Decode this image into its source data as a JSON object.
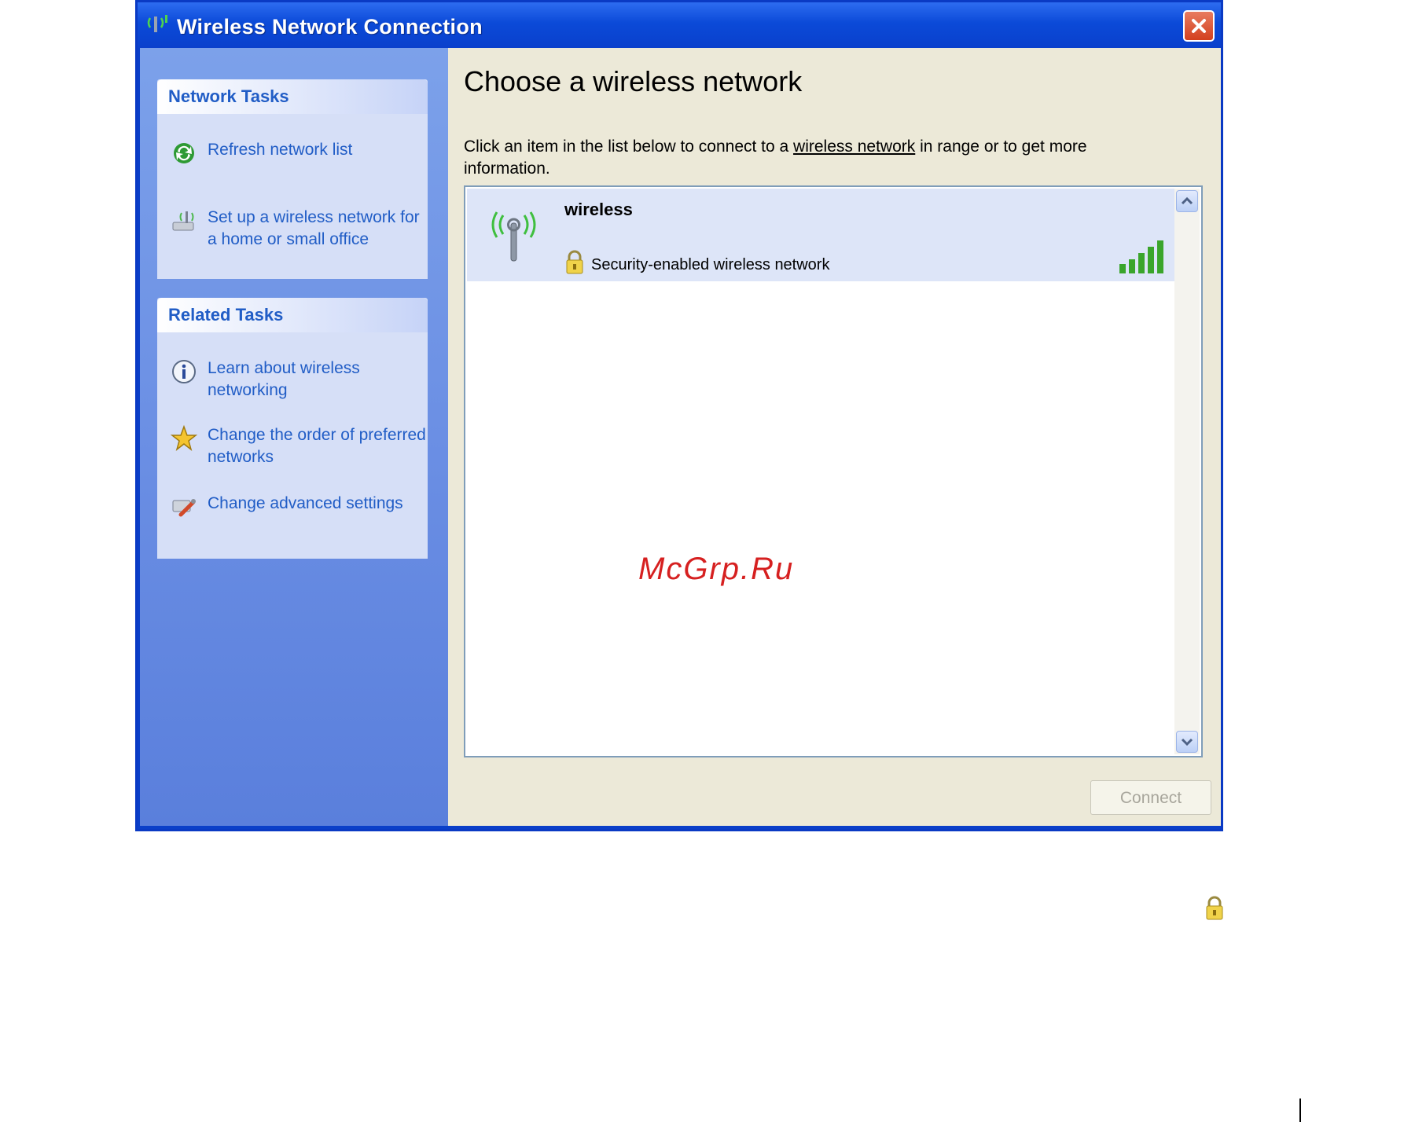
{
  "window": {
    "title": "Wireless Network Connection",
    "title_icon": "wireless-network-icon",
    "close_icon": "close-icon"
  },
  "sidebar": {
    "network_tasks": {
      "header": "Network Tasks",
      "items": [
        {
          "label": "Refresh network list",
          "icon": "refresh-icon"
        },
        {
          "label": "Set up a wireless network for a home or small office",
          "icon": "setup-network-icon"
        }
      ]
    },
    "related_tasks": {
      "header": "Related Tasks",
      "items": [
        {
          "label": "Learn about wireless networking",
          "icon": "info-icon"
        },
        {
          "label": "Change the order of preferred networks",
          "icon": "star-icon"
        },
        {
          "label": "Change advanced settings",
          "icon": "settings-icon"
        }
      ]
    }
  },
  "main": {
    "heading": "Choose a wireless network",
    "instruction_pre": "Click an item in the list below to connect to a ",
    "instruction_link": "wireless network",
    "instruction_post": " in range or to get more information.",
    "networks": [
      {
        "name": "wireless",
        "security": "Security-enabled wireless network",
        "signal_bars": 5,
        "signal_max": 5
      }
    ],
    "connect_label": "Connect"
  },
  "watermark": "McGrp.Ru",
  "colors": {
    "title_bar": "#0a40cc",
    "sidebar": "#6b8fe4",
    "task_link": "#215dc6",
    "selected_row": "#dde5f8",
    "signal_green": "#3aa52b",
    "watermark_red": "#d62020"
  }
}
